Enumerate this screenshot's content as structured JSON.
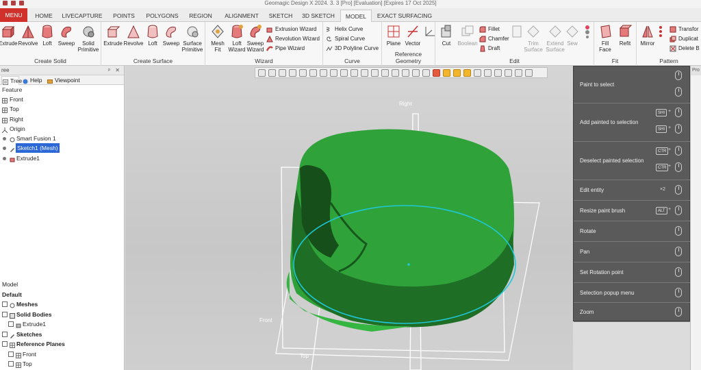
{
  "window": {
    "title": "Geomagic Design X 2024. 3. 3 [Pro] [Evaluation] [Expires 17 Oct 2025]"
  },
  "tabs": [
    "MENU",
    "HOME",
    "LIVECAPTURE",
    "POINTS",
    "POLYGONS",
    "REGION",
    "ALIGNMENT",
    "SKETCH",
    "3D SKETCH",
    "MODEL",
    "EXACT SURFACING"
  ],
  "active_tab": "MODEL",
  "ribbon": {
    "create_solid": {
      "label": "Create Solid",
      "buttons": [
        "Extrude",
        "Revolve",
        "Loft",
        "Sweep",
        "Solid Primitive"
      ]
    },
    "create_surface": {
      "label": "Create Surface",
      "buttons": [
        "Extrude",
        "Revolve",
        "Loft",
        "Sweep",
        "Surface Primitive"
      ]
    },
    "wizard": {
      "label": "Wizard",
      "buttons": [
        "Mesh Fit",
        "Loft Wizard",
        "Sweep Wizard"
      ],
      "small": [
        "Extrusion Wizard",
        "Revolution Wizard",
        "Pipe Wizard"
      ]
    },
    "curve": {
      "label": "Curve",
      "small": [
        "Helix Curve",
        "Spiral Curve",
        "3D Polyline Curve"
      ]
    },
    "reference_geometry": {
      "label": "Reference Geometry",
      "buttons": [
        "Plane",
        "Vector"
      ]
    },
    "edit": {
      "label": "Edit",
      "buttons": [
        "Cut",
        "Boolean"
      ],
      "small": [
        "Fillet",
        "Chamfer",
        "Draft"
      ],
      "gray": [
        "Trim Surface",
        "Extend Surface",
        "Sew"
      ]
    },
    "fit": {
      "label": "Fit",
      "buttons": [
        "Fill Face",
        "Refit"
      ]
    },
    "pattern": {
      "label": "Pattern",
      "buttons": [
        "Mirror"
      ],
      "small": [
        "Transfor",
        "Duplicat",
        "Delete B"
      ]
    }
  },
  "left_panel": {
    "header": "ree",
    "tabs": [
      "Tree",
      "Help",
      "Viewpoint"
    ],
    "feature_title": "Feature",
    "feature_items": [
      "Front",
      "Top",
      "Right",
      "Origin",
      "Smart Fusion 1",
      "Sketch1 (Mesh)",
      "Extrude1"
    ],
    "model_title": "Model",
    "model_items": [
      "Default",
      "Meshes",
      "Solid Bodies",
      "Extrude1",
      "Sketches",
      "Reference Planes",
      "Front",
      "Top"
    ]
  },
  "viewport": {
    "plane_labels": [
      "Right",
      "Front",
      "Top"
    ],
    "colors": {
      "mesh": "#2fa33a",
      "mesh_dark": "#1a6b22",
      "circle": "#1fc7d8",
      "plane": "#ffffff"
    }
  },
  "help_popup": {
    "items": [
      {
        "label": "Paint to select"
      },
      {
        "label": "Add painted to selection",
        "keys": [
          "SHI",
          "SHI"
        ]
      },
      {
        "label": "Deselect painted selection",
        "keys": [
          "CTR",
          "CTR"
        ]
      },
      {
        "label": "Edit entity",
        "extra": "×2"
      },
      {
        "label": "Resize paint brush",
        "keys": [
          "ALT"
        ]
      },
      {
        "label": "Rotate"
      },
      {
        "label": "Pan"
      },
      {
        "label": "Set Rotation point"
      },
      {
        "label": "Selection popup menu"
      },
      {
        "label": "Zoom"
      }
    ]
  },
  "right_panel": {
    "header": "Pro"
  }
}
